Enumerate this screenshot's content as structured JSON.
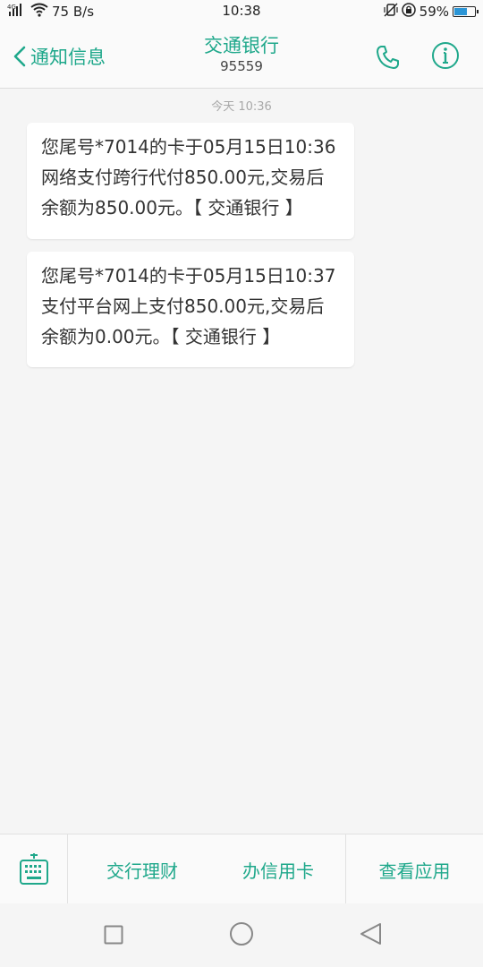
{
  "status_bar": {
    "network": "4G",
    "speed": "75 B/s",
    "time": "10:38",
    "battery_percent_text": "59%",
    "battery_level": 0.59
  },
  "header": {
    "back_label": "通知信息",
    "title": "交通银行",
    "subtitle": "95559"
  },
  "messages": {
    "timestamp": "今天 10:36",
    "items": [
      {
        "text": "您尾号*7014的卡于05月15日10:36网络支付跨行代付850.00元,交易后余额为850.00元。【 交通银行 】"
      },
      {
        "text": "您尾号*7014的卡于05月15日10:37支付平台网上支付850.00元,交易后余额为0.00元。【 交通银行 】"
      }
    ]
  },
  "toolbar": {
    "keyboard_icon": "keyboard-icon",
    "items": [
      "交行理财",
      "办信用卡",
      "查看应用"
    ]
  },
  "navbar": {
    "recent_icon": "square-icon",
    "home_icon": "circle-icon",
    "back_icon": "triangle-back-icon"
  },
  "colors": {
    "accent": "#1fa88b",
    "battery": "#2b95d6",
    "background": "#f5f5f5"
  }
}
